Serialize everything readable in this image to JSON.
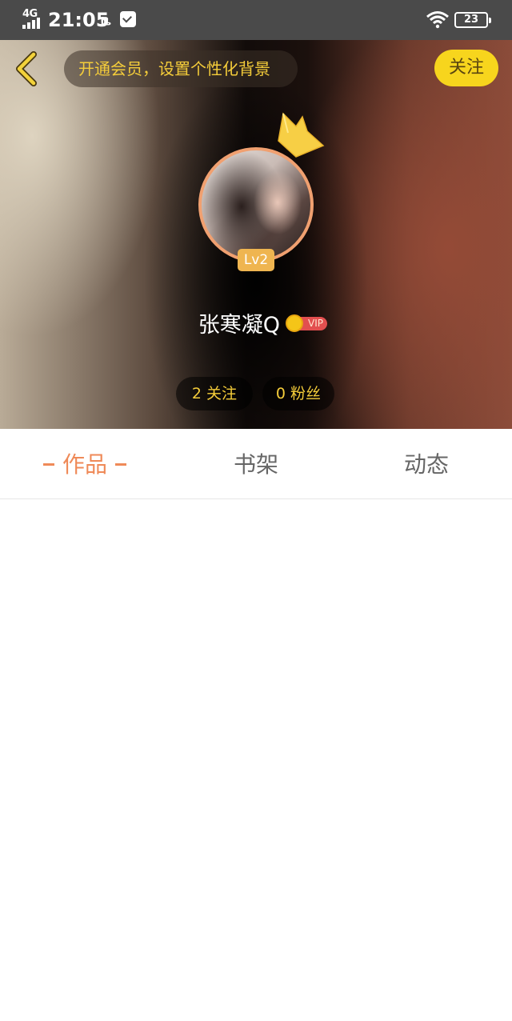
{
  "status_bar": {
    "network": "4G",
    "time": "21:05",
    "battery": "23"
  },
  "header": {
    "back_icon": "chevron-left-icon",
    "vip_banner": "开通会员，设置个性化背景",
    "follow_button": "关注",
    "level_badge": "Lv2",
    "username": "张寒凝Q",
    "vip_tag": "VIP",
    "stats": {
      "following": "2 关注",
      "fans": "0 粉丝"
    }
  },
  "tabs": [
    {
      "label": "作品",
      "active": true
    },
    {
      "label": "书架",
      "active": false
    },
    {
      "label": "动态",
      "active": false
    }
  ],
  "colors": {
    "accent": "#ef8a58",
    "gold": "#f5cd3a",
    "follow_bg": "#f7d51d"
  }
}
